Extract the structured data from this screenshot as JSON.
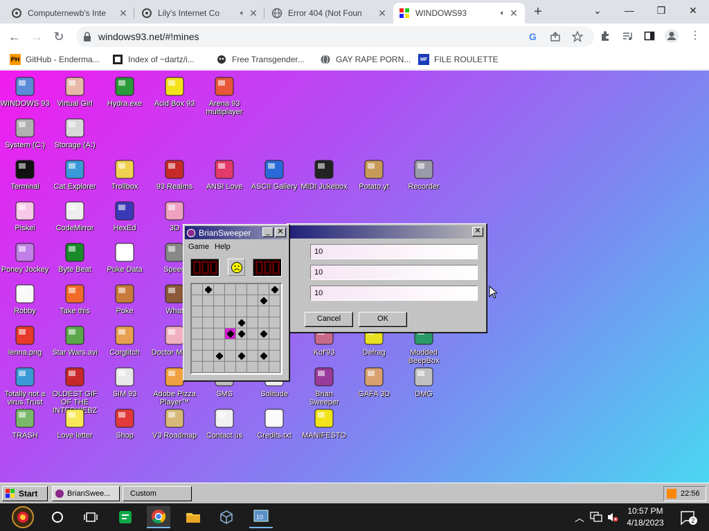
{
  "browser": {
    "tabs": [
      {
        "title": "Computernewb's Inte",
        "favicon": "computernewb-icon",
        "audio": false
      },
      {
        "title": "Lily's Internet Co",
        "favicon": "computernewb-icon",
        "audio": true
      },
      {
        "title": "Error 404 (Not Foun",
        "favicon": "globe-icon",
        "audio": false
      },
      {
        "title": "WINDOWS93",
        "favicon": "windows93-icon",
        "audio": true,
        "active": true
      }
    ],
    "new_tab": "+",
    "window": {
      "menu": "⌄",
      "minimize": "—",
      "restore": "❐",
      "close": "✕"
    },
    "url": "windows93.net/#!mines",
    "bookmarks": [
      {
        "label": "GitHub - Enderma...",
        "icon": "PH"
      },
      {
        "label": "Index of ~dartz/i...",
        "icon": "film-icon"
      },
      {
        "label": "Free Transgender...",
        "icon": "mask-icon"
      },
      {
        "label": "GAY RAPE PORN...",
        "icon": "globe-icon"
      },
      {
        "label": "FILE ROULETTE",
        "icon": "MF"
      }
    ]
  },
  "desktop": {
    "icons": [
      {
        "label": "WINDOWS 93",
        "icon": "computer-icon"
      },
      {
        "label": "Virtual Girl",
        "icon": "face-icon"
      },
      {
        "label": "Hydra.exe",
        "icon": "dragon-icon"
      },
      {
        "label": "Acid Box 93",
        "icon": "smiley-icon"
      },
      {
        "label": "Arena 93 multiplayer",
        "icon": "cube-icon"
      },
      {
        "label": "System (C:)",
        "icon": "drive-icon"
      },
      {
        "label": "Storage (A:)",
        "icon": "floppy-drive-icon"
      },
      {
        "label": "Terminal",
        "icon": "terminal-icon"
      },
      {
        "label": "Cat Explorer",
        "icon": "globe-cat-icon"
      },
      {
        "label": "Trollbox",
        "icon": "chat-icon"
      },
      {
        "label": "93 Realms",
        "icon": "realms-icon"
      },
      {
        "label": "ANSI Love",
        "icon": "ansi-icon"
      },
      {
        "label": "ASCII Gallery",
        "icon": "ascii-icon"
      },
      {
        "label": "MIDI Jukebox",
        "icon": "piano-icon"
      },
      {
        "label": "Potato.yt",
        "icon": "potato-icon"
      },
      {
        "label": "Recorder",
        "icon": "microphone-icon"
      },
      {
        "label": "Piskel",
        "icon": "palette-icon"
      },
      {
        "label": "CodeMirror",
        "icon": "codemirror-icon"
      },
      {
        "label": "HexEd",
        "icon": "hexed-icon"
      },
      {
        "label": "3D",
        "icon": "teapot-icon"
      },
      {
        "label": "Poney Jockey",
        "icon": "pony-icon"
      },
      {
        "label": "Byte Beat",
        "icon": "bytebeat-icon"
      },
      {
        "label": "Puke Data",
        "icon": "pd-icon"
      },
      {
        "label": "Speed",
        "icon": "speed-icon"
      },
      {
        "label": "Robby",
        "icon": "robot-icon"
      },
      {
        "label": "Take this",
        "icon": "takethis-icon"
      },
      {
        "label": "Poke",
        "icon": "poke-icon"
      },
      {
        "label": "What",
        "icon": "what-icon"
      },
      {
        "label": "lenna.png",
        "icon": "image-file-icon"
      },
      {
        "label": "Star Wars.avi",
        "icon": "yoda-icon"
      },
      {
        "label": "Corglitch",
        "icon": "corgi-icon"
      },
      {
        "label": "Doctor Marbu",
        "icon": "doctor-icon"
      },
      {
        "label": "Kof'93",
        "icon": "fighter-icon"
      },
      {
        "label": "Defrag",
        "icon": "defrag-icon"
      },
      {
        "label": "Modded BeepBox",
        "icon": "beepbox-icon"
      },
      {
        "label": "Totally not a virus.Trust me...",
        "icon": "dolphin-icon"
      },
      {
        "label": "OLDEST GIF OF THE INTERWEBZ",
        "icon": "gif-file-icon"
      },
      {
        "label": "SIM 93",
        "icon": "book-icon"
      },
      {
        "label": "Adobe Pizza Player™",
        "icon": "pizza-icon"
      },
      {
        "label": "SMS",
        "icon": "sms-icon"
      },
      {
        "label": "Solitude",
        "icon": "solitude-icon"
      },
      {
        "label": "Brian Sweeper",
        "icon": "mine-icon"
      },
      {
        "label": "GAFA 3D",
        "icon": "gafa-icon"
      },
      {
        "label": "DMG",
        "icon": "dmg-icon"
      },
      {
        "label": "TRASH",
        "icon": "trash-icon"
      },
      {
        "label": "Love letter",
        "icon": "letter-icon"
      },
      {
        "label": "Shop",
        "icon": "gift-icon"
      },
      {
        "label": "V3 Roadmap",
        "icon": "map-icon"
      },
      {
        "label": "Contact us",
        "icon": "contact-icon"
      },
      {
        "label": "Credits.txt",
        "icon": "text-file-icon"
      },
      {
        "label": "MANIFESTO",
        "icon": "question-icon"
      }
    ]
  },
  "dialog": {
    "close": "✕",
    "fields": [
      "10",
      "10",
      "10"
    ],
    "cancel": "Cancel",
    "ok": "OK"
  },
  "minesweeper": {
    "title": "BrianSweeper",
    "menu": [
      "Game",
      "Help"
    ],
    "counter_left": "000",
    "counter_right": "000",
    "face": "sad-face-icon",
    "grid_size": 8,
    "mines": [
      [
        1,
        0
      ],
      [
        3,
        4
      ],
      [
        4,
        3
      ],
      [
        4,
        4
      ],
      [
        4,
        6
      ],
      [
        2,
        8
      ],
      [
        2,
        6
      ],
      [
        6,
        1
      ],
      [
        6,
        4
      ],
      [
        6,
        6
      ],
      [
        7,
        0
      ]
    ],
    "exploded": [
      3,
      4
    ],
    "win_buttons": {
      "minimize": "_",
      "close": "✕"
    }
  },
  "w93_taskbar": {
    "start": "Start",
    "items": [
      "BrianSwee...",
      "Custom"
    ],
    "clock": "22:56"
  },
  "windows_taskbar": {
    "time": "10:57 PM",
    "date": "4/18/2023",
    "notifications": "2"
  },
  "colors": {
    "w93_title_start": "#20207a",
    "w93_title_end": "#b8b8b8",
    "accent_boom": "#d21fd2"
  }
}
